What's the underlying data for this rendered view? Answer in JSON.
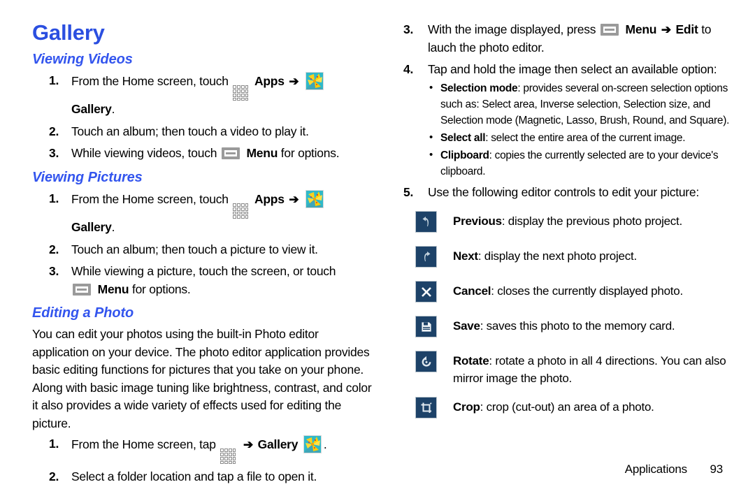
{
  "document": {
    "title": "Gallery",
    "footer": {
      "section": "Applications",
      "page_number": "93"
    },
    "colors": {
      "heading_blue": "#2b4fe0",
      "subheading_blue": "#3355ee",
      "icon_button_bg": "#1d4268",
      "menu_icon_gray": "#9a9a9a",
      "gallery_thumb_bg": "#2fb9c9"
    }
  },
  "left_column": {
    "page_title": "Gallery",
    "sections": [
      {
        "heading": "Viewing Videos",
        "steps": [
          {
            "num": "1.",
            "text_before_apps": "From the Home screen, touch",
            "apps_label": "Apps",
            "arrow": "➔",
            "gallery_label": "Gallery",
            "trailing": "."
          },
          {
            "num": "2.",
            "text": "Touch an album; then touch a video to play it."
          },
          {
            "num": "3.",
            "text_before_menu": "While viewing videos, touch",
            "menu_label": "Menu",
            "text_after_menu": "for options."
          }
        ]
      },
      {
        "heading": "Viewing Pictures",
        "steps": [
          {
            "num": "1.",
            "text_before_apps": "From the Home screen, touch",
            "apps_label": "Apps",
            "arrow": "➔",
            "gallery_label": "Gallery",
            "trailing": "."
          },
          {
            "num": "2.",
            "text": "Touch an album; then touch a picture to view it."
          },
          {
            "num": "3.",
            "text_before_menu": "While viewing a picture, touch the screen, or touch",
            "menu_label": "Menu",
            "text_after_menu": "for options."
          }
        ]
      },
      {
        "heading": "Editing a Photo",
        "body": "You can edit your photos using the built-in Photo editor application on your device. The photo editor application provides basic editing functions for pictures that you take on your phone. Along with basic image tuning like brightness, contrast, and color it also provides a wide variety of effects used for editing the picture.",
        "steps": [
          {
            "num": "1.",
            "text_before_apps": "From the Home screen, tap",
            "arrow": "➔",
            "gallery_label": "Gallery",
            "trailing": "."
          },
          {
            "num": "2.",
            "text": "Select a folder location and tap a file to open it."
          }
        ]
      }
    ]
  },
  "right_column": {
    "steps": [
      {
        "num": "3.",
        "text_before_menu": "With the image displayed, press",
        "menu_label": "Menu",
        "arrow": "➔",
        "edit_label": "Edit",
        "text_after": "to lauch the photo editor."
      },
      {
        "num": "4.",
        "text": "Tap and hold the image then select an available option:",
        "bullets": [
          {
            "term": "Selection mode",
            "desc": ": provides several on-screen selection options such as: Select area, Inverse selection, Selection size, and Selection mode (Magnetic, Lasso, Brush, Round, and Square)."
          },
          {
            "term": "Select all",
            "desc": ": select the entire area of the current image."
          },
          {
            "term": "Clipboard",
            "desc": ": copies the currently selected are to your device's clipboard."
          }
        ]
      },
      {
        "num": "5.",
        "text": "Use the following editor controls to edit your picture:"
      }
    ],
    "editor_controls": [
      {
        "icon": "undo-arrow-icon",
        "term": "Previous",
        "desc": ": display the previous photo project."
      },
      {
        "icon": "redo-arrow-icon",
        "term": "Next",
        "desc": ": display the next photo project."
      },
      {
        "icon": "close-x-icon",
        "term": "Cancel",
        "desc": ": closes the currently displayed photo."
      },
      {
        "icon": "floppy-disk-save-icon",
        "term": "Save",
        "desc": ": saves this photo to the memory card."
      },
      {
        "icon": "rotate-icon",
        "term": "Rotate",
        "desc": ": rotate a photo in all 4 directions. You can also mirror image the photo."
      },
      {
        "icon": "crop-icon",
        "term": "Crop",
        "desc": ": crop (cut-out) an area of a photo."
      }
    ]
  }
}
